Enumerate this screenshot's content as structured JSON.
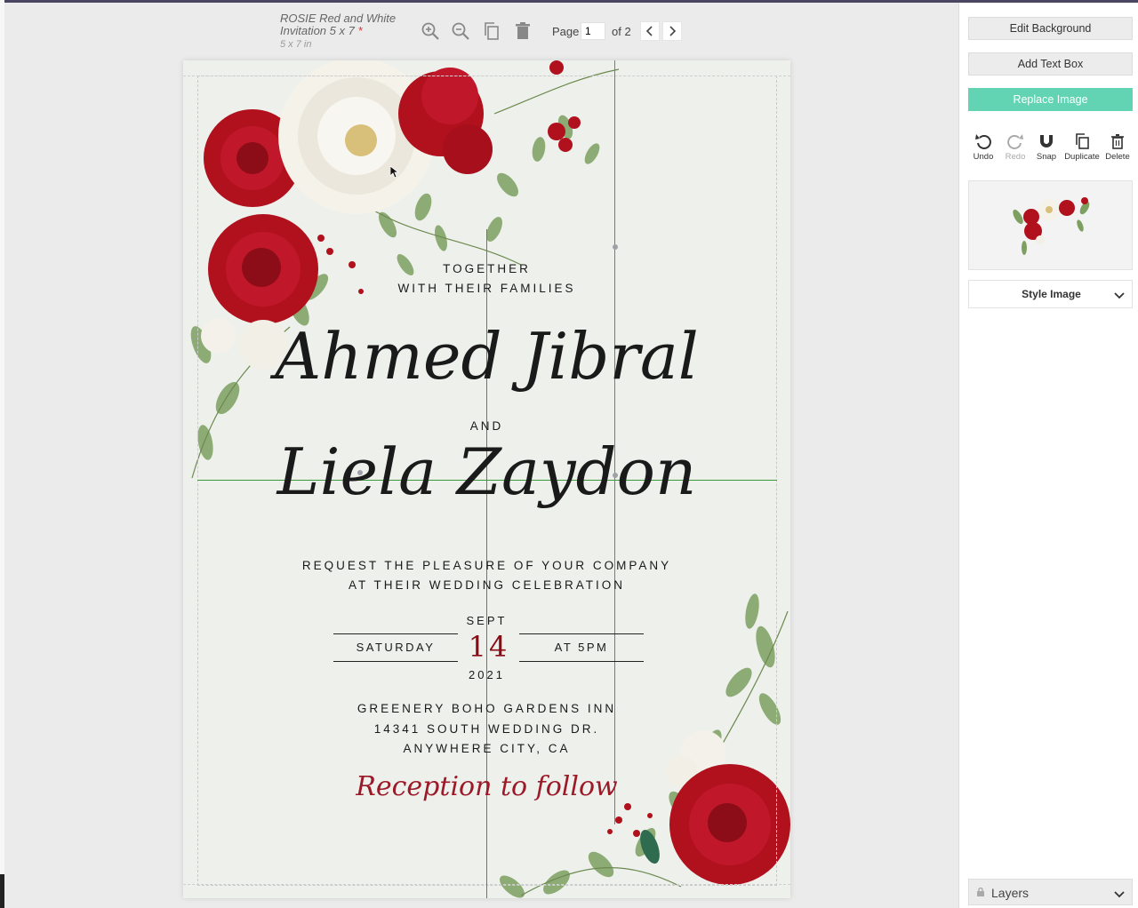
{
  "header": {
    "title": "ROSIE Red and White Invitation 5 x 7",
    "unsaved_mark": "*",
    "size": "5 x 7 in",
    "page_label": "Page",
    "page_value": "1",
    "page_total": "of 2"
  },
  "toolbar": {
    "icons": [
      "zoom-in-icon",
      "zoom-out-icon",
      "copy-page-icon",
      "trash-icon",
      "chevron-left-icon",
      "chevron-right-icon"
    ]
  },
  "invitation": {
    "intro_line1": "TOGETHER",
    "intro_line2": "WITH THEIR FAMILIES",
    "name1": "Ahmed Jibral",
    "and": "AND",
    "name2": "Liela Zaydon",
    "request_line1": "REQUEST THE PLEASURE OF YOUR COMPANY",
    "request_line2": "AT THEIR WEDDING CELEBRATION",
    "month": "SEPT",
    "weekday": "SATURDAY",
    "day": "14",
    "time": "AT 5PM",
    "year": "2021",
    "venue_line1": "GREENERY BOHO GARDENS INN",
    "venue_line2": "14341 SOUTH WEDDING DR.",
    "venue_line3": "ANYWHERE CITY, CA",
    "reception": "Reception to follow"
  },
  "panel": {
    "edit_background": "Edit Background",
    "add_text_box": "Add Text Box",
    "replace_image": "Replace Image",
    "actions": [
      "Undo",
      "Redo",
      "Snap",
      "Duplicate",
      "Delete"
    ],
    "style_image": "Style Image",
    "layers": "Layers"
  },
  "colors": {
    "accent_teal": "#62d3b3",
    "rose_red": "#b0111d",
    "date_red": "#8b0a14",
    "guide_green": "#3a9a3a",
    "guide_magenta": "#d63ad6"
  }
}
